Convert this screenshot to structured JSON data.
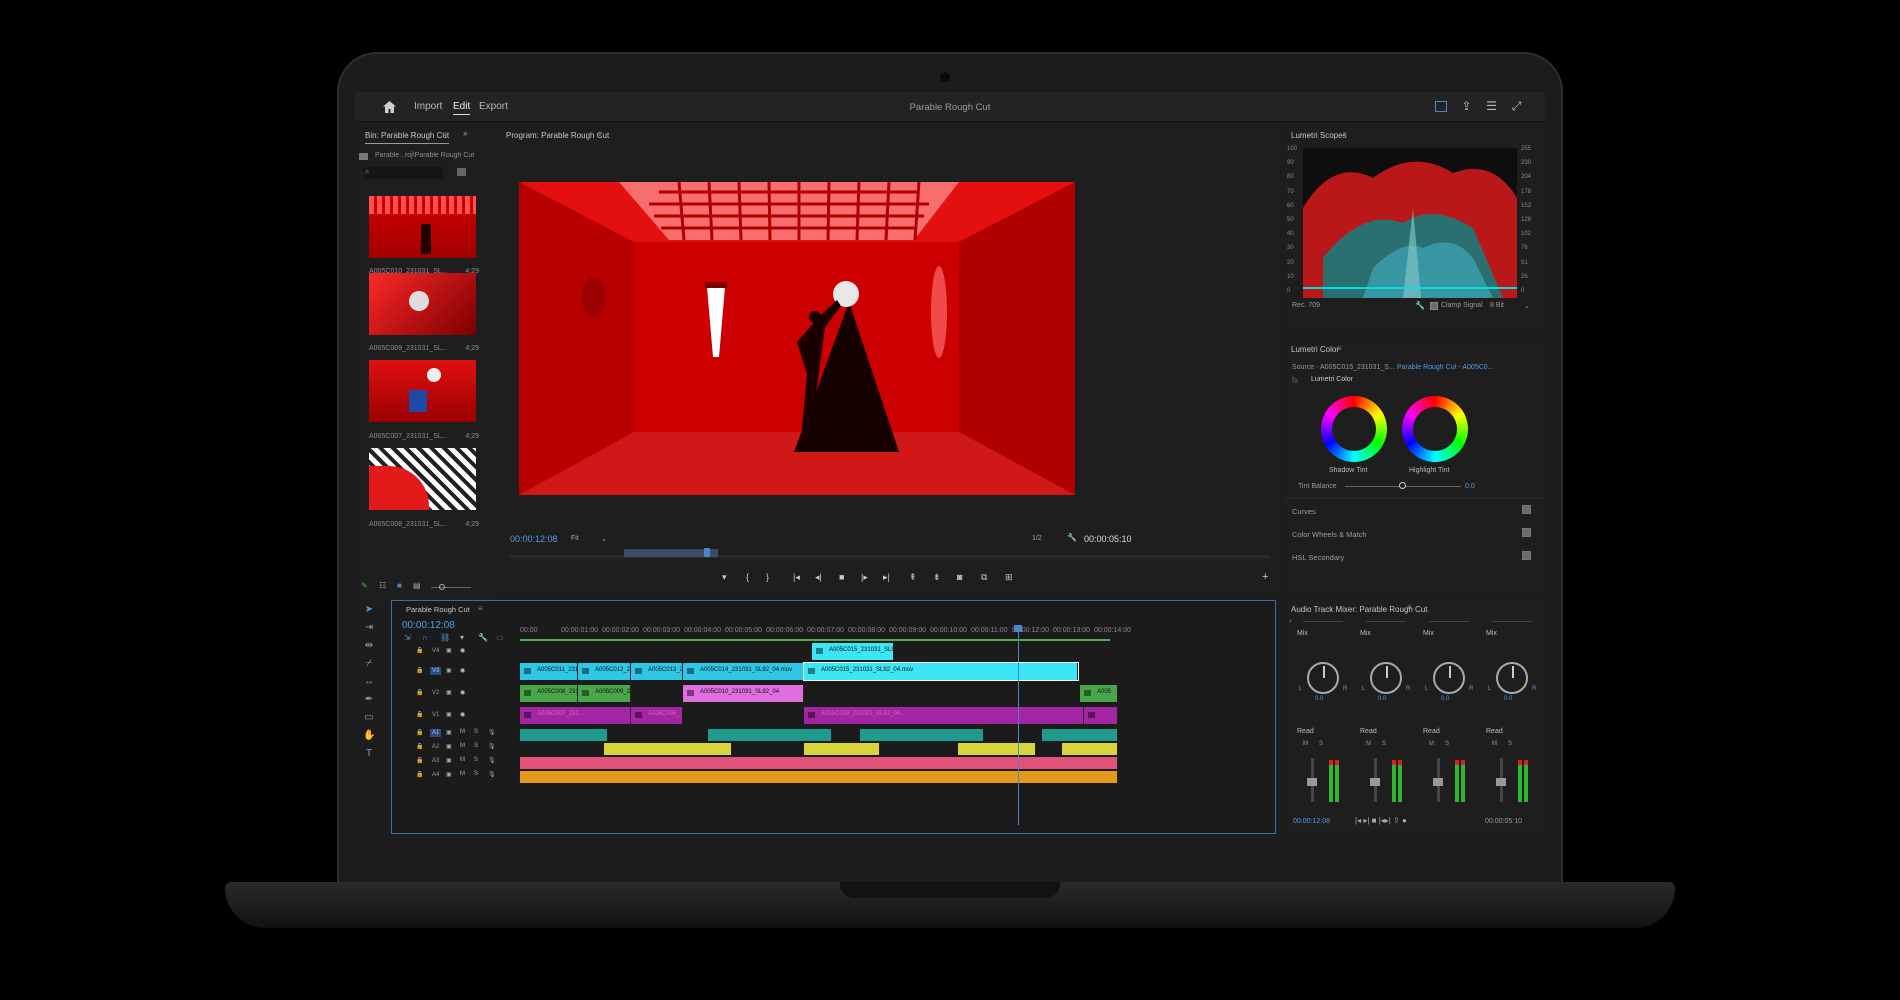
{
  "topbar": {
    "nav": [
      "Import",
      "Edit",
      "Export"
    ],
    "active_nav": "Edit",
    "title": "Parable Rough Cut",
    "icons": [
      "home-icon",
      "panel-layout-icon",
      "share-icon",
      "menu-icon",
      "fullscreen-icon"
    ]
  },
  "bin": {
    "tab": "Bin: Parable Rough Cut",
    "path": "Parable...roj\\Parable Rough Cut",
    "clips": [
      {
        "name": "A005C010_231031_SL...",
        "duration": "4;29"
      },
      {
        "name": "A005C009_231031_SL...",
        "duration": "4;29"
      },
      {
        "name": "A005C007_231031_SL...",
        "duration": "4;29"
      },
      {
        "name": "A005C008_231031_SL...",
        "duration": "4;29"
      }
    ]
  },
  "program": {
    "tab": "Program: Parable Rough Cut",
    "timecode": "00:00:12:08",
    "fit": "Fit",
    "resolution": "1/2",
    "duration": "00:00:05:10"
  },
  "timeline": {
    "tab": "Parable Rough Cut",
    "timecode": "00:00:12:08",
    "ruler": [
      "00:00",
      "00:00:01:00",
      "00:00:02:00",
      "00:00:03:00",
      "00:00:04:00",
      "00:00:05:00",
      "00:00:06:00",
      "00:00:07:00",
      "00:00:08:00",
      "00:00:09:00",
      "00:00:10:00",
      "00:00:11:00",
      "00:00:12:00",
      "00:00:13:00",
      "00:00:14:00"
    ],
    "tracks": [
      "V4",
      "V3",
      "V2",
      "V1",
      "A1",
      "A2",
      "A3",
      "A4"
    ],
    "clips": {
      "v4": [
        "A005C015_231031_SL92_0"
      ],
      "v3": [
        "A005C011_2310",
        "A005C012_231",
        "A005C013_23",
        "A005C014_231031_SL92_04.mov",
        "A005C015_231031_SL92_04.mov"
      ],
      "v2": [
        "A005C008_2310",
        "A005C009_231",
        "A005C010_231031_SL92_04",
        "A005"
      ],
      "v1": [
        "A005C007_231...",
        "A005C006_...",
        "A005C008_231031_SL92_04..."
      ]
    },
    "colors": {
      "cyan": "#2ec8e6",
      "bright_cyan": "#3be6f5",
      "green": "#4aa64a",
      "pink": "#e06ee0",
      "purple": "#a425a4",
      "teal": "#1f9a8c",
      "yellow": "#d8d43a",
      "salmon": "#e2537a",
      "orange": "#e39a1a"
    }
  },
  "scopes": {
    "tab": "Lumetri Scopes",
    "left_scale": [
      "100",
      "90",
      "80",
      "70",
      "60",
      "50",
      "40",
      "30",
      "20",
      "10",
      "0"
    ],
    "right_scale": [
      "255",
      "230",
      "204",
      "178",
      "153",
      "128",
      "102",
      "76",
      "51",
      "26",
      "0"
    ],
    "mode": "Rec. 709",
    "clamp": "Clamp Signal",
    "bits": "8 Bit"
  },
  "lumetri": {
    "tab": "Lumetri Color",
    "source": "Source - A005C015_231031_S...",
    "sequence": "Parable Rough Cut - A005C0...",
    "effect": "Lumetri Color",
    "wheels": [
      "Shadow Tint",
      "Highlight Tint"
    ],
    "tint_label": "Tint Balance",
    "tint_value": "0.0",
    "sections": [
      "Curves",
      "Color Wheels & Match",
      "HSL Secondary"
    ]
  },
  "mixer": {
    "tab": "Audio Track Mixer: Parable Rough Cut",
    "channels": [
      {
        "mode": "Mix",
        "value": "0.0",
        "automation": "Read"
      },
      {
        "mode": "Mix",
        "value": "0.0",
        "automation": "Read"
      },
      {
        "mode": "Mix",
        "value": "0.0",
        "automation": "Read"
      },
      {
        "mode": "Mix",
        "value": "0.0",
        "automation": "Read"
      }
    ],
    "timecode": "00:00:12:08",
    "duration": "00:00:05:10"
  }
}
